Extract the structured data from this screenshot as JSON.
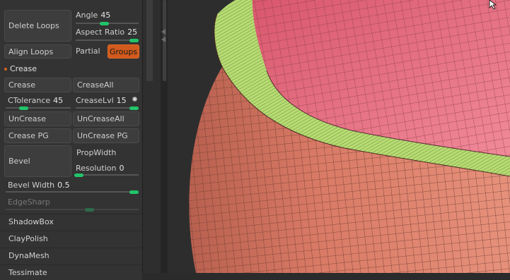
{
  "loops": {
    "delete_loops": "Delete Loops",
    "angle_label": "Angle",
    "angle_value": "45",
    "aspect_ratio_label": "Aspect Ratio",
    "aspect_ratio_value": "25",
    "align_loops": "Align Loops",
    "partial": "Partial",
    "groups": "Groups",
    "angle_level": 0.45,
    "aspect_ratio_level": 1.0
  },
  "crease": {
    "section_title": "Crease",
    "crease_button": "Crease",
    "crease_all": "CreaseAll",
    "ctolerance_label": "CTolerance",
    "ctolerance_value": "45",
    "creaselvl_label": "CreaseLvl",
    "creaselvl_value": "15",
    "uncrease": "UnCrease",
    "uncrease_all": "UnCreaseAll",
    "crease_pg": "Crease PG",
    "uncrease_pg": "UnCrease PG",
    "bevel": "Bevel",
    "propwidth": "PropWidth",
    "resolution_label": "Resolution",
    "resolution_value": "0",
    "bevel_width_label": "Bevel Width",
    "bevel_width_value": "0.5",
    "edgesharp": "EdgeSharp",
    "ctolerance_level": 0.3,
    "creaselvl_level": 1.0,
    "resolution_level": 0.0,
    "bevel_width_level": 1.0
  },
  "menus": [
    "ShadowBox",
    "ClayPolish",
    "DynaMesh",
    "Tessimate"
  ],
  "colors": {
    "accent_slider": "#22c46a",
    "groups_active": "#d15a1c",
    "mesh_outer": "#d97a66",
    "mesh_top": "#e07383",
    "mesh_rim": "#b7dc72"
  }
}
